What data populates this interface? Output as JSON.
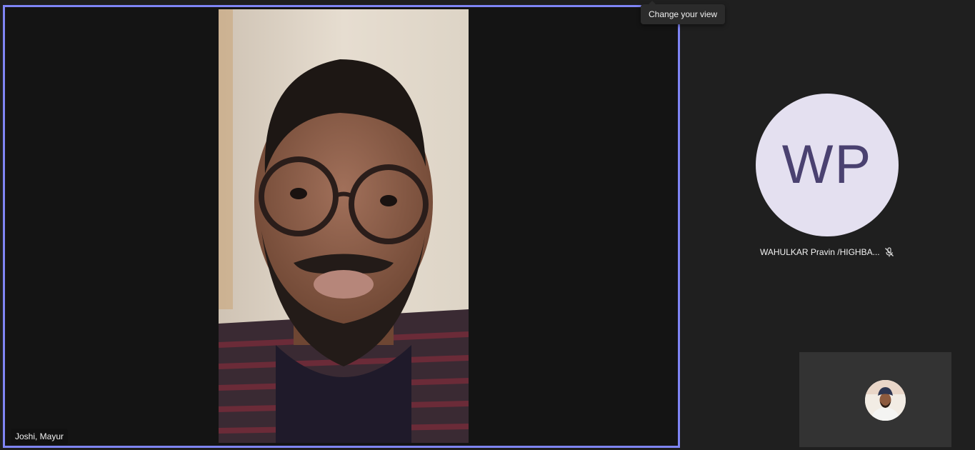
{
  "tooltip": {
    "text": "Change your view"
  },
  "main_speaker": {
    "name": "Joshi, Mayur",
    "highlight_color": "#7f85f5"
  },
  "participant": {
    "initials": "WP",
    "name": "WAHULKAR Pravin /HIGHBA...",
    "mic_status_icon": "mic-off-icon",
    "avatar_bg": "#e4e0f0",
    "avatar_fg": "#4a4170"
  },
  "self_view": {
    "avatar_icon": "user-photo-avatar"
  }
}
